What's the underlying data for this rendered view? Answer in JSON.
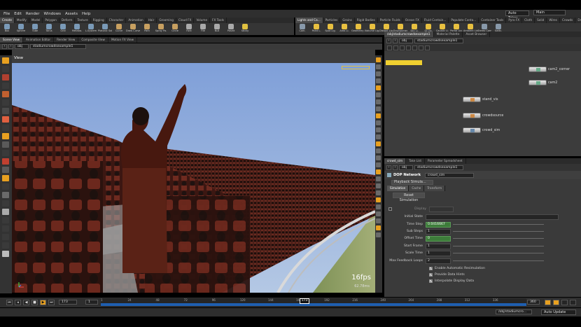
{
  "menu": {
    "items": [
      "File",
      "Edit",
      "Render",
      "Windows",
      "Assets",
      "Help"
    ],
    "desktop_tokens": "Auto Takes",
    "desktop": "Main"
  },
  "shelf_tabs_left": [
    "Create",
    "Modify",
    "Model",
    "Polygon",
    "Deform",
    "Texture",
    "Rigging",
    "Character",
    "Animation",
    "Hair",
    "Grooming",
    "Cloud FX",
    "Volume",
    "FX Tools"
  ],
  "shelf_tabs_right": [
    "Lights and Ca...",
    "Particles",
    "Grains",
    "Rigid Bodies",
    "Particle Fluids",
    "Ocean FX",
    "Fluid Contain...",
    "Populate Conta...",
    "Container Tools",
    "Pyro FX",
    "Cloth",
    "Solid",
    "Wires",
    "Crowds",
    "Drive Simulat..."
  ],
  "shelf_tools_left": [
    {
      "label": "Box",
      "color": "#7a9ab8"
    },
    {
      "label": "Sphere",
      "color": "#7a9ab8"
    },
    {
      "label": "Tube",
      "color": "#7a9ab8"
    },
    {
      "label": "Torus",
      "color": "#7a9ab8"
    },
    {
      "label": "Grid",
      "color": "#7a9ab8"
    },
    {
      "label": "Metaba.",
      "color": "#7a9ab8"
    },
    {
      "label": "L-System",
      "color": "#7a9ab8"
    },
    {
      "label": "Platonic Sol.",
      "color": "#7a9ab8"
    },
    {
      "label": "Curve",
      "color": "#c8a060"
    },
    {
      "label": "Draw Curve",
      "color": "#c8a060"
    },
    {
      "label": "Path",
      "color": "#c8a060"
    },
    {
      "label": "Spray Pa.",
      "color": "#c8a060"
    },
    {
      "label": "Circle",
      "color": "#c8a060"
    },
    {
      "label": "Font",
      "color": "#aaaaaa"
    },
    {
      "label": "File",
      "color": "#aaaaaa"
    },
    {
      "label": "Null",
      "color": "#aaaaaa"
    },
    {
      "label": "Poseit",
      "color": "#aaaaaa"
    },
    {
      "label": "Sticky",
      "color": "#e0c040"
    }
  ],
  "shelf_tools_right": [
    {
      "label": "Cam.",
      "color": "#8899aa"
    },
    {
      "label": "Point L.",
      "color": "#e8c040"
    },
    {
      "label": "Spot Lig.",
      "color": "#e8c040"
    },
    {
      "label": "Area Li.",
      "color": "#e8c040"
    },
    {
      "label": "Geometry L.",
      "color": "#e8c040"
    },
    {
      "label": "Volume Lig.",
      "color": "#e8c040"
    },
    {
      "label": "Distant Lig.",
      "color": "#e8c040"
    },
    {
      "label": "Environmen.",
      "color": "#e8c040"
    },
    {
      "label": "Sky Li.",
      "color": "#e8c040"
    },
    {
      "label": "GI Lig.",
      "color": "#e8c040"
    },
    {
      "label": "Caustic Li.",
      "color": "#e8c040"
    },
    {
      "label": "Portal Lig.",
      "color": "#e8c040"
    },
    {
      "label": "Ambient Lig.",
      "color": "#e8c040"
    },
    {
      "label": "Stereo Cam.",
      "color": "#8899aa"
    },
    {
      "label": "Switc.",
      "color": "#8899aa"
    }
  ],
  "left_panel": {
    "tabs": [
      "Scene View",
      "Animation Editor",
      "Render View",
      "Composite View",
      "Motion FX View"
    ],
    "path_root": "obj",
    "path_node": "stadiumcrowdsexample1",
    "viewport_label": "View",
    "fps": "16fps",
    "ms": "62.78ms"
  },
  "network_panel": {
    "tabs": [
      "/obj/stadiumcrowdsexample1",
      "Material Palette",
      "Asset Browser"
    ],
    "path_root": "obj",
    "path_node": "stadiumcrowdsexample1",
    "nodes": [
      "cam2_corner",
      "cam2",
      "stand_vis",
      "crowdsource",
      "crowd_sim"
    ]
  },
  "parm_panel": {
    "tabs": [
      "crowd_sim",
      "Take List",
      "Parameter Spreadsheet"
    ],
    "path_root": "obj",
    "path_node": "stadiumcrowdsexample1",
    "node_type": "DOP Network",
    "node_name": "crowd_sim",
    "playback_mode": "Playback Simula...",
    "sub_tabs": [
      "Simulation",
      "Cache",
      "Transform"
    ],
    "reset_label": "Reset Simulation",
    "params": [
      {
        "label": "Display",
        "value": ""
      },
      {
        "label": "Initial State",
        "value": ""
      },
      {
        "label": "Time Step",
        "value": "0.0416667"
      },
      {
        "label": "Sub Steps",
        "value": "1"
      },
      {
        "label": "Offset Time",
        "value": "0"
      },
      {
        "label": "Start Frame",
        "value": "1"
      },
      {
        "label": "Scale Time",
        "value": "1"
      },
      {
        "label": "Max Feedback Loops",
        "value": "2"
      }
    ],
    "checks": [
      "Enable Automatic Resimulation",
      "Provide Data Hints",
      "Interpolate Display Data"
    ]
  },
  "timeline": {
    "current_frame": "173",
    "start": "1",
    "end": "360",
    "ticks": [
      "1",
      "24",
      "48",
      "72",
      "96",
      "120",
      "144",
      "168",
      "192",
      "216",
      "240",
      "264",
      "288",
      "312",
      "336"
    ]
  },
  "status": {
    "path": "/obj/stadiumcro...",
    "auto_update": "Auto Update"
  },
  "colors": {
    "accent_orange": "#e8a020",
    "timeline_blue": "#1f5fb0",
    "field_green": "#3d7c3a",
    "node_yellow": "#f0d030"
  }
}
